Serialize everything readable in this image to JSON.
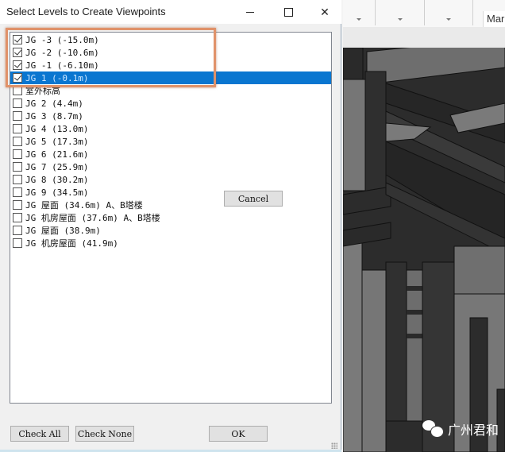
{
  "dialog": {
    "title": "Select Levels to Create Viewpoints",
    "window_controls": [
      "minimize-icon",
      "maximize-icon",
      "close-icon"
    ],
    "levels": [
      {
        "label": "JG -3 (-15.0m)",
        "checked": true,
        "selected": false
      },
      {
        "label": "JG -2 (-10.6m)",
        "checked": true,
        "selected": false
      },
      {
        "label": "JG -1 (-6.10m)",
        "checked": true,
        "selected": false
      },
      {
        "label": "JG 1 (-0.1m)",
        "checked": true,
        "selected": true
      },
      {
        "label": "室外标高",
        "checked": false,
        "selected": false
      },
      {
        "label": "JG 2 (4.4m)",
        "checked": false,
        "selected": false
      },
      {
        "label": "JG 3 (8.7m)",
        "checked": false,
        "selected": false
      },
      {
        "label": "JG 4 (13.0m)",
        "checked": false,
        "selected": false
      },
      {
        "label": "JG 5 (17.3m)",
        "checked": false,
        "selected": false
      },
      {
        "label": "JG 6 (21.6m)",
        "checked": false,
        "selected": false
      },
      {
        "label": "JG 7 (25.9m)",
        "checked": false,
        "selected": false
      },
      {
        "label": "JG 8 (30.2m)",
        "checked": false,
        "selected": false
      },
      {
        "label": "JG 9 (34.5m)",
        "checked": false,
        "selected": false
      },
      {
        "label": "JG 屋面 (34.6m) A、B塔楼",
        "checked": false,
        "selected": false
      },
      {
        "label": "JG 机房屋面 (37.6m) A、B塔楼",
        "checked": false,
        "selected": false
      },
      {
        "label": "JG 屋面 (38.9m)",
        "checked": false,
        "selected": false
      },
      {
        "label": "JG 机房屋面 (41.9m)",
        "checked": false,
        "selected": false
      }
    ],
    "buttons": {
      "cancel": "Cancel",
      "check_all": "Check All",
      "check_none": "Check None",
      "ok": "OK"
    },
    "highlight_color": "#e0926a",
    "selection_color": "#0a76d0"
  },
  "background_app": {
    "markup_tab": "Markl",
    "watermark": "广州君和"
  }
}
